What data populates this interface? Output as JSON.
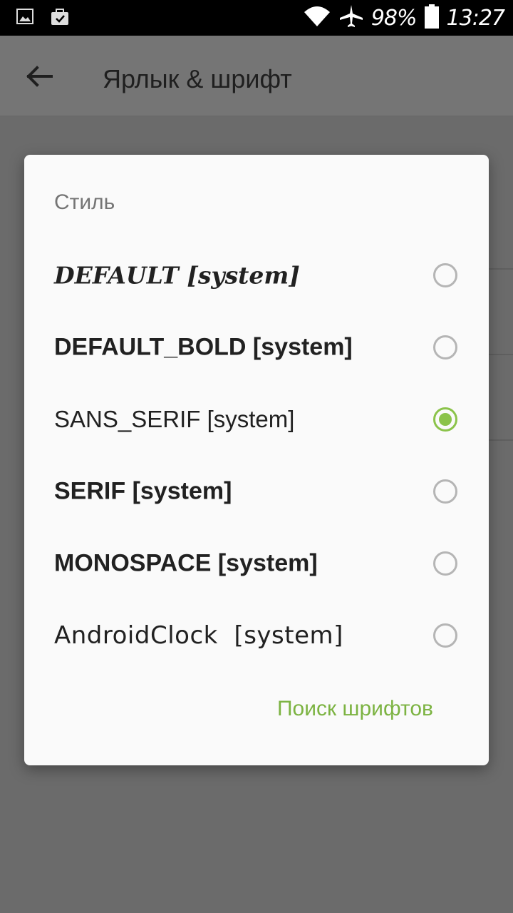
{
  "status_bar": {
    "battery": "98%",
    "time": "13:27",
    "icons": [
      "image-icon",
      "briefcase-check-icon",
      "wifi-icon",
      "airplane-icon",
      "battery-icon"
    ]
  },
  "app_bar": {
    "title": "Ярлык & шрифт",
    "back_icon": "arrow-left-icon"
  },
  "dialog": {
    "title": "Стиль",
    "options": [
      {
        "label": "DEFAULT [system]",
        "selected": false
      },
      {
        "label": "DEFAULT_BOLD [system]",
        "selected": false
      },
      {
        "label": "SANS_SERIF [system]",
        "selected": true
      },
      {
        "label": "SERIF [system]",
        "selected": false
      },
      {
        "label": "MONOSPACE [system]",
        "selected": false
      },
      {
        "label": "AndroidClock  [system]",
        "selected": false
      }
    ],
    "action_label": "Поиск шрифтов"
  },
  "colors": {
    "accent": "#8bc34a",
    "scrim": "#6b6b6b",
    "dialog_bg": "#fafafa"
  }
}
